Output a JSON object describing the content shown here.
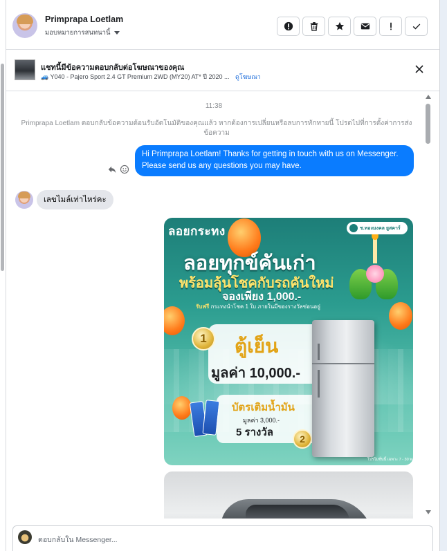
{
  "header": {
    "contact_name": "Primprapa Loetlam",
    "assign_label": "มอบหมายการสนทนานี้",
    "actions": [
      {
        "icon": "alert-circle-icon",
        "name": "mark-spam-button"
      },
      {
        "icon": "trash-icon",
        "name": "delete-button"
      },
      {
        "icon": "star-icon",
        "name": "star-button"
      },
      {
        "icon": "envelope-icon",
        "name": "mark-unread-button"
      },
      {
        "icon": "exclamation-icon",
        "name": "follow-up-button"
      },
      {
        "icon": "check-icon",
        "name": "mark-done-button"
      }
    ]
  },
  "ad_banner": {
    "title": "แชทนี้มีข้อความตอบกลับต่อโฆษณาของคุณ",
    "subtitle": "🚙 Y040 - Pajero Sport 2.4 GT Premium 2WD (MY20) AT* ปี 2020 ...",
    "link": "ดูโฆษณา"
  },
  "conversation": {
    "timestamp": "11:38",
    "system_notice": "Primprapa Loetlam ตอบกลับข้อความต้อนรับอัตโนมัติของคุณแล้ว หากต้องการเปลี่ยนหรือลบการทักทายนี้ โปรดไปที่การตั้งค่าการส่งข้อความ",
    "outgoing_message": "Hi Primprapa Loetlam! Thanks for getting in touch with us on Messenger. Please send us any questions you may have.",
    "incoming_message": "เลขไมล์เท่าไหร่คะ"
  },
  "promo": {
    "brand": "ลอยกระทง",
    "logo_text": "ช.ทองมงคล ยูสคาร์",
    "headline1": "ลอยทุกข์คันเก่า",
    "headline2": "พร้อมลุ้นโชคกับรถคันใหม่",
    "headline3": "จองเพียง 1,000.-",
    "gift_prefix": "รับฟรี",
    "gift_text": "กระทงนำโชค 1 ใบ ภายในมีของรางวัลซ่อนอยู่",
    "prize1_rank": "1",
    "prize1_name": "ตู้เย็น",
    "prize1_value": "มูลค่า 10,000.-",
    "prize2_rank": "2",
    "prize2_name": "บัตรเติมน้ำมัน",
    "prize2_value": "มูลค่า 3,000.-",
    "prize2_count": "5 รางวัล",
    "footnote": "โปรโมชั่นนี้ เฉพาะ 7 - 30 พ.ย. 65 เท่านั้น"
  },
  "composer": {
    "placeholder": "ตอบกลับใน Messenger..."
  }
}
